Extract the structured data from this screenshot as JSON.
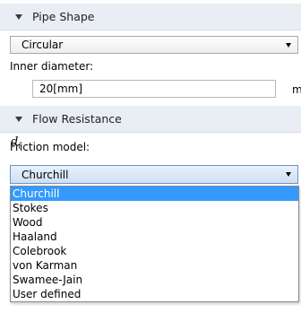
{
  "pipe_shape": {
    "header": "Pipe Shape",
    "shape_value": "Circular",
    "inner_diameter_label": "Inner diameter:",
    "symbol_main": "d",
    "symbol_sub": "i",
    "diameter_value": "20[mm]",
    "unit_cut": "m"
  },
  "flow_resistance": {
    "header": "Flow Resistance",
    "friction_label": "Friction model:",
    "selected": "Churchill",
    "options": [
      "Churchill",
      "Stokes",
      "Wood",
      "Haaland",
      "Colebrook",
      "von Karman",
      "Swamee-Jain",
      "User defined"
    ]
  }
}
